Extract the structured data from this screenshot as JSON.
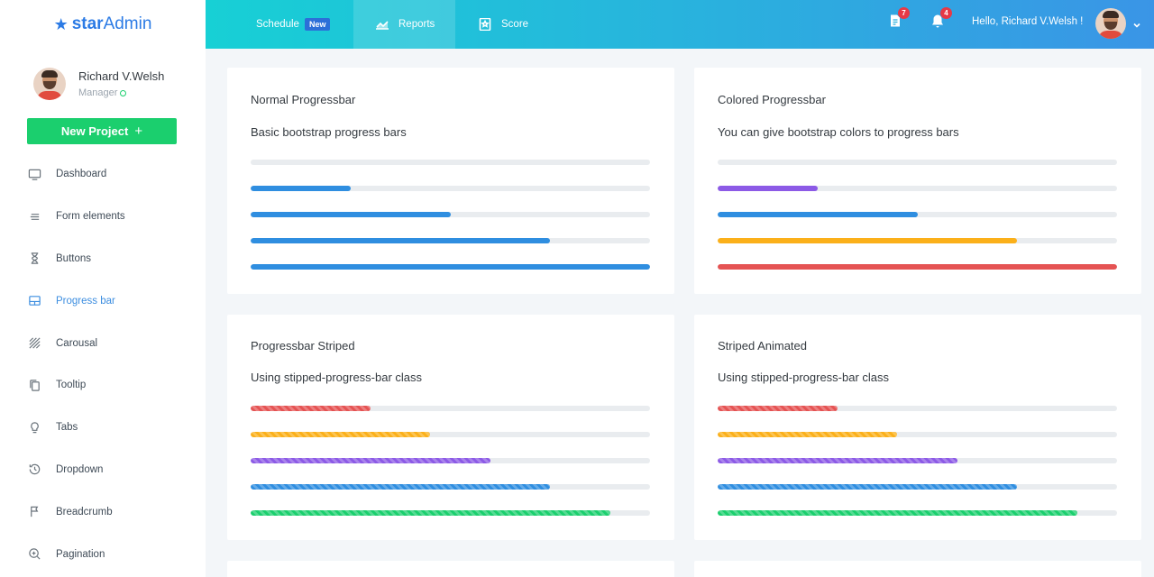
{
  "brand": {
    "star": "★",
    "part1": "star",
    "part2": "Admin"
  },
  "user": {
    "name": "Richard V.Welsh",
    "role": "Manager"
  },
  "new_project": {
    "label": "New Project",
    "icon": "+"
  },
  "nav": [
    {
      "label": "Dashboard",
      "icon": "monitor-icon"
    },
    {
      "label": "Form elements",
      "icon": "lines-icon"
    },
    {
      "label": "Buttons",
      "icon": "hourglass-icon"
    },
    {
      "label": "Progress bar",
      "icon": "layout-icon",
      "active": true
    },
    {
      "label": "Carousal",
      "icon": "hatch-icon"
    },
    {
      "label": "Tooltip",
      "icon": "copy-icon"
    },
    {
      "label": "Tabs",
      "icon": "bulb-icon"
    },
    {
      "label": "Dropdown",
      "icon": "history-icon"
    },
    {
      "label": "Breadcrumb",
      "icon": "flag-icon"
    },
    {
      "label": "Pagination",
      "icon": "zoom-in-icon"
    }
  ],
  "header": {
    "tabs": {
      "schedule": "Schedule",
      "schedule_badge": "New",
      "reports": "Reports",
      "score": "Score"
    },
    "messages_count": "7",
    "notifications_count": "4",
    "greeting": "Hello, Richard V.Welsh !"
  },
  "colors": {
    "blue": "#2f8ee0",
    "purple": "#8c5ae6",
    "yellow": "#fbb01a",
    "red": "#e55353",
    "green": "#1bcf6e",
    "track": "#e9ecef"
  },
  "cards": {
    "normal": {
      "title": "Normal Progressbar",
      "description": "Basic bootstrap progress bars",
      "bars": [
        {
          "value": 0,
          "color": "#2f8ee0"
        },
        {
          "value": 25,
          "color": "#2f8ee0"
        },
        {
          "value": 50,
          "color": "#2f8ee0"
        },
        {
          "value": 75,
          "color": "#2f8ee0"
        },
        {
          "value": 100,
          "color": "#2f8ee0"
        }
      ]
    },
    "colored": {
      "title": "Colored Progressbar",
      "description": "You can give bootstrap colors to progress bars",
      "bars": [
        {
          "value": 0,
          "color": "#2f8ee0"
        },
        {
          "value": 25,
          "color": "#8c5ae6"
        },
        {
          "value": 50,
          "color": "#2f8ee0"
        },
        {
          "value": 75,
          "color": "#fbb01a"
        },
        {
          "value": 100,
          "color": "#e55353"
        }
      ]
    },
    "striped": {
      "title": "Progressbar Striped",
      "description": "Using stipped-progress-bar class",
      "bars": [
        {
          "value": 30,
          "color": "#e55353"
        },
        {
          "value": 45,
          "color": "#fbb01a"
        },
        {
          "value": 60,
          "color": "#8c5ae6"
        },
        {
          "value": 75,
          "color": "#2f8ee0"
        },
        {
          "value": 90,
          "color": "#1bcf6e"
        }
      ]
    },
    "animated": {
      "title": "Striped Animated",
      "description": "Using stipped-progress-bar class",
      "bars": [
        {
          "value": 30,
          "color": "#e55353"
        },
        {
          "value": 45,
          "color": "#fbb01a"
        },
        {
          "value": 60,
          "color": "#8c5ae6"
        },
        {
          "value": 75,
          "color": "#2f8ee0"
        },
        {
          "value": 90,
          "color": "#1bcf6e"
        }
      ]
    }
  }
}
